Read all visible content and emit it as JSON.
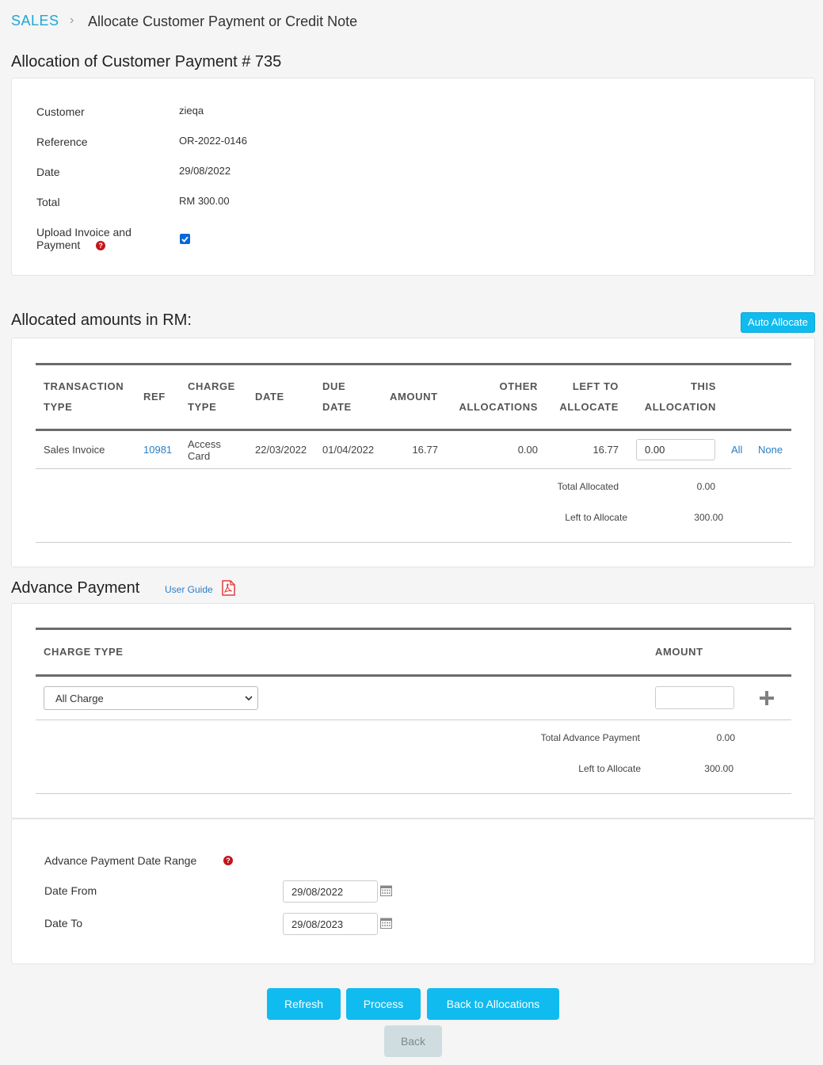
{
  "breadcrumb": {
    "root": "SALES",
    "separator": "›",
    "current": "Allocate Customer Payment or Credit Note"
  },
  "allocation_title": "Allocation of Customer Payment # 735",
  "payment_info": {
    "customer_label": "Customer",
    "customer_value": "zieqa",
    "reference_label": "Reference",
    "reference_value": "OR-2022-0146",
    "date_label": "Date",
    "date_value": "29/08/2022",
    "total_label": "Total",
    "total_value": "RM 300.00",
    "upload_label_line1": "Upload Invoice and",
    "upload_label_line2": "Payment",
    "upload_checked": true
  },
  "allocated": {
    "title": "Allocated amounts in RM:",
    "auto_allocate_label": "Auto Allocate",
    "headers": {
      "transaction_type_1": "TRANSACTION",
      "transaction_type_2": "TYPE",
      "ref": "REF",
      "charge_type_1": "CHARGE",
      "charge_type_2": "TYPE",
      "date": "DATE",
      "due_date_1": "DUE",
      "due_date_2": "DATE",
      "amount": "AMOUNT",
      "other_alloc_1": "OTHER",
      "other_alloc_2": "ALLOCATIONS",
      "left_1": "LEFT TO",
      "left_2": "ALLOCATE",
      "this_1": "THIS",
      "this_2": "ALLOCATION"
    },
    "rows": [
      {
        "transaction_type": "Sales Invoice",
        "ref": "10981",
        "charge_type_1": "Access",
        "charge_type_2": "Card",
        "date": "22/03/2022",
        "due_date": "01/04/2022",
        "amount": "16.77",
        "other_allocations": "0.00",
        "left_to_allocate": "16.77",
        "this_allocation": "0.00",
        "all_label": "All",
        "none_label": "None"
      }
    ],
    "total_allocated_label": "Total Allocated",
    "total_allocated_value": "0.00",
    "left_label": "Left to Allocate",
    "left_value": "300.00"
  },
  "advance": {
    "title": "Advance Payment",
    "user_guide_label": "User Guide",
    "charge_type_header": "CHARGE TYPE",
    "amount_header": "AMOUNT",
    "charge_select_value": "All Charge",
    "amount_value": "",
    "total_label": "Total Advance Payment",
    "total_value": "0.00",
    "left_label": "Left to Allocate",
    "left_value": "300.00"
  },
  "date_range": {
    "title": "Advance Payment Date Range",
    "from_label": "Date From",
    "from_value": "29/08/2022",
    "to_label": "Date To",
    "to_value": "29/08/2023"
  },
  "actions": {
    "refresh": "Refresh",
    "process": "Process",
    "back_to_allocations": "Back to Allocations",
    "back": "Back"
  },
  "colors": {
    "accent": "#0fbbef",
    "link": "#2a7ec7",
    "help": "#c0171c",
    "pdf": "#e23b3b"
  }
}
